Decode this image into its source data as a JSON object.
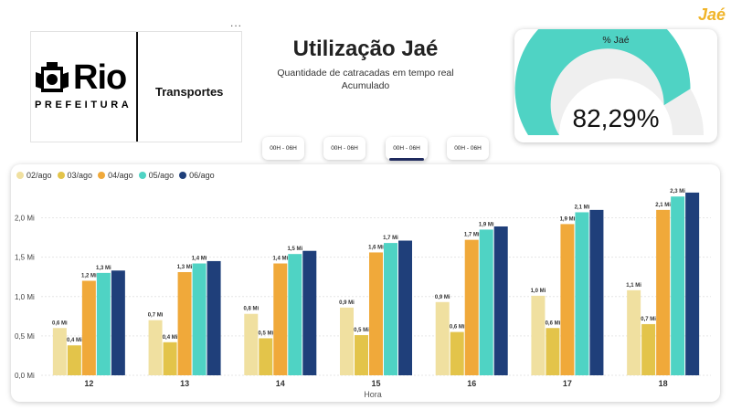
{
  "header": {
    "title": "Utilização Jaé",
    "subtitle": "Quantidade de catracadas em tempo real",
    "subtitle2": "Acumulado",
    "brand": "Jaé",
    "more": "..."
  },
  "logo": {
    "city": "Rio",
    "prefeitura": "PREFEITURA",
    "section": "Transportes"
  },
  "gauge": {
    "title": "% Jaé",
    "value_label": "82,29%",
    "value": 82.29,
    "fill_color": "#4fd3c4",
    "track_color": "#efefef"
  },
  "tabs": [
    {
      "label": "00H - 06H"
    },
    {
      "label": "00H - 06H"
    },
    {
      "label": "00H - 06H",
      "active": true
    },
    {
      "label": "00H - 06H"
    }
  ],
  "chart_data": {
    "type": "bar",
    "xlabel": "Hora",
    "ylabel": "",
    "categories": [
      "12",
      "13",
      "14",
      "15",
      "16",
      "17",
      "18"
    ],
    "ylim": [
      0,
      2.4
    ],
    "y_ticks": [
      "0,0 Mi",
      "0,5 Mi",
      "1,0 Mi",
      "1,5 Mi",
      "2,0 Mi"
    ],
    "y_tick_values": [
      0,
      0.5,
      1.0,
      1.5,
      2.0
    ],
    "grid": true,
    "legend_position": "top-left",
    "series": [
      {
        "name": "02/ago",
        "color": "#f0e0a0",
        "values": [
          0.6,
          0.7,
          0.78,
          0.86,
          0.93,
          1.01,
          1.08
        ],
        "labels": [
          "0,6 Mi",
          "0,7 Mi",
          "0,8 Mi",
          "0,9 Mi",
          "0,9 Mi",
          "1,0 Mi",
          "1,1 Mi"
        ]
      },
      {
        "name": "03/ago",
        "color": "#e3c44a",
        "values": [
          0.38,
          0.42,
          0.47,
          0.51,
          0.55,
          0.6,
          0.65
        ],
        "labels": [
          "0,4 Mi",
          "0,4 Mi",
          "0,5 Mi",
          "0,5 Mi",
          "0,6 Mi",
          "0,6 Mi",
          "0,7 Mi"
        ]
      },
      {
        "name": "04/ago",
        "color": "#f0a93a",
        "values": [
          1.2,
          1.31,
          1.42,
          1.56,
          1.72,
          1.92,
          2.1
        ],
        "labels": [
          "1,2 Mi",
          "1,3 Mi",
          "1,4 Mi",
          "1,6 Mi",
          "1,7 Mi",
          "1,9 Mi",
          "2,1 Mi"
        ]
      },
      {
        "name": "05/ago",
        "color": "#4fd3c4",
        "values": [
          1.3,
          1.42,
          1.54,
          1.68,
          1.85,
          2.07,
          2.27
        ],
        "labels": [
          "1,3 Mi",
          "1,4 Mi",
          "1,5 Mi",
          "1,7 Mi",
          "1,9 Mi",
          "2,1 Mi",
          "2,3 Mi"
        ]
      },
      {
        "name": "06/ago",
        "color": "#1f3f7a",
        "values": [
          1.33,
          1.45,
          1.58,
          1.71,
          1.89,
          2.1,
          2.32
        ],
        "labels": [
          "",
          "",
          "",
          "",
          "",
          "",
          ""
        ]
      }
    ]
  }
}
